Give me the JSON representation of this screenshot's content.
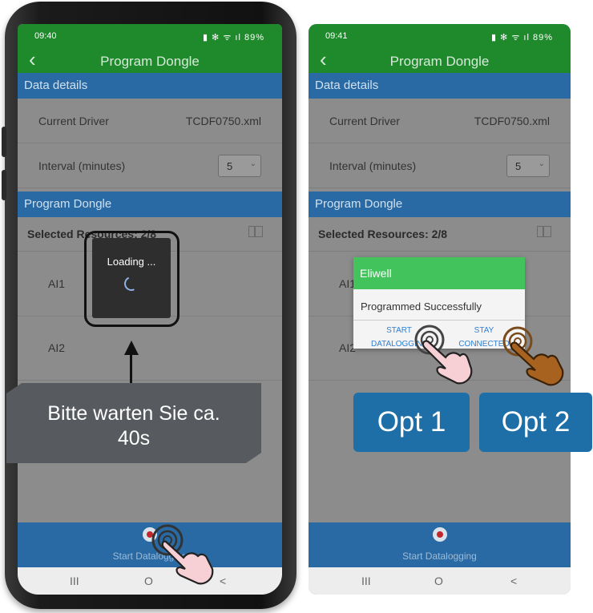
{
  "screen_left": {
    "status_time": "09:40",
    "status_icons": "▮ ✻ ᯤ ıl 89%",
    "appbar_title": "Program Dongle",
    "data_details_header": "Data details",
    "current_driver_label": "Current Driver",
    "current_driver_value": "TCDF0750.xml",
    "interval_label": "Interval (minutes)",
    "interval_value": "5",
    "program_dongle_header": "Program Dongle",
    "selected_resources": "Selected Resources: 2/8",
    "resources": [
      "AI1",
      "AI2"
    ],
    "loading_text": "Loading ...",
    "start_datalogging_label": "Start Datalogging",
    "nav": {
      "recents": "III",
      "home": "O",
      "back": "<"
    }
  },
  "screen_right": {
    "status_time": "09:41",
    "status_icons": "▮ ✻ ᯤ ıl 89%",
    "appbar_title": "Program Dongle",
    "data_details_header": "Data details",
    "current_driver_label": "Current Driver",
    "current_driver_value": "TCDF0750.xml",
    "interval_label": "Interval (minutes)",
    "interval_value": "5",
    "program_dongle_header": "Program Dongle",
    "selected_resources": "Selected Resources: 2/8",
    "resources": [
      "AI1",
      "AI2"
    ],
    "dialog": {
      "title": "Eliwell",
      "message": "Programmed Successfully",
      "btn_start_1": "START",
      "btn_start_2": "DATALOGGING",
      "btn_stay_1": "STAY",
      "btn_stay_2": "CONNECTED"
    },
    "start_datalogging_label": "Start Datalogging",
    "nav": {
      "recents": "III",
      "home": "O",
      "back": "<"
    }
  },
  "annotations": {
    "callout_line1": "Bitte warten Sie ca.",
    "callout_line2": "40s",
    "opt1_label": "Opt 1",
    "opt2_label": "Opt 2"
  },
  "colors": {
    "app_green": "#1f8a2c",
    "section_blue": "#2a6aa4",
    "dialog_green": "#42c35b",
    "option_blue": "#1e6fa8",
    "record_red": "#c0272d"
  }
}
